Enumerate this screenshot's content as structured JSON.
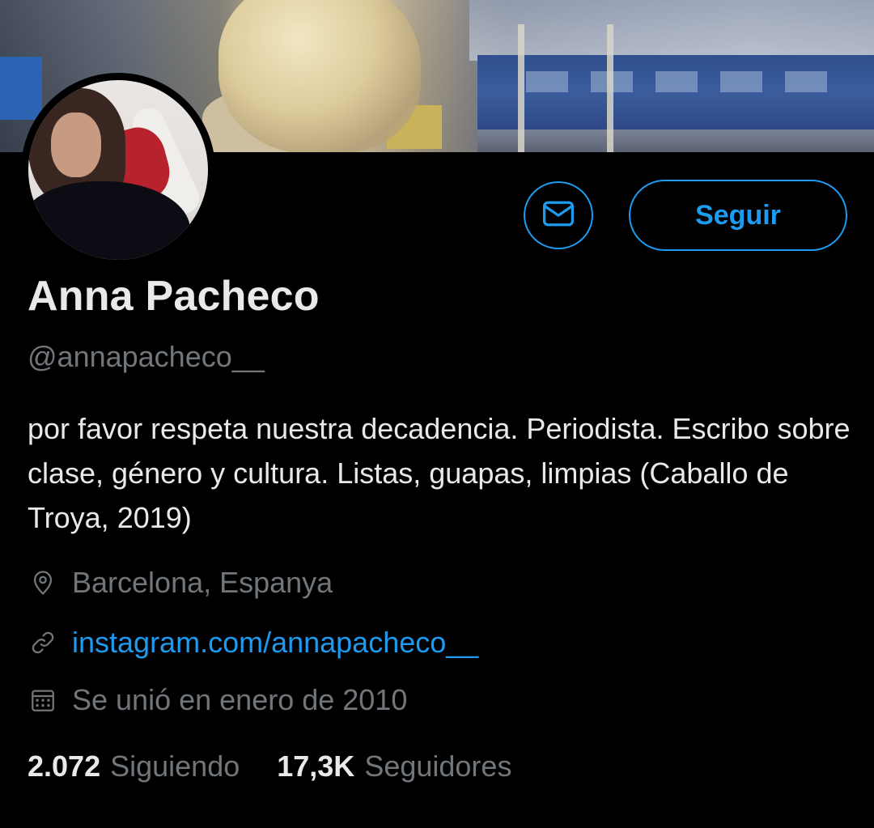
{
  "profile": {
    "name": "Anna Pacheco",
    "handle": "@annapacheco__",
    "bio": "por favor respeta nuestra decadencia. Periodista. Escribo sobre clase, género y cultura. Listas, guapas, limpias (Caballo de Troya, 2019)",
    "location": "Barcelona, Espanya",
    "website": "instagram.com/annapacheco__",
    "joined": "Se unió en enero de 2010"
  },
  "actions": {
    "follow_label": "Seguir",
    "message_icon": "envelope-icon"
  },
  "stats": {
    "following_count": "2.072",
    "following_label": "Siguiendo",
    "followers_count": "17,3K",
    "followers_label": "Seguidores"
  },
  "icons": {
    "location": "map-pin-icon",
    "website": "link-icon",
    "joined": "calendar-icon"
  },
  "colors": {
    "background": "#000000",
    "accent": "#1d9bf0",
    "primary_text": "#e7e9ea",
    "secondary_text": "#71767b"
  }
}
